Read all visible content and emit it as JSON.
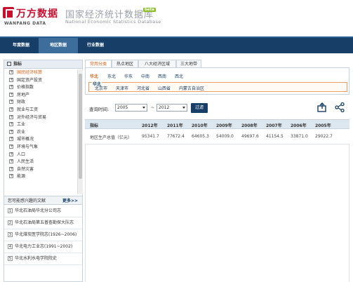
{
  "header": {
    "logo_cn": "万方数据",
    "logo_en": "WANFANG DATA",
    "site_title_cn": "国家经济统计数据库",
    "site_title_en": "National Economic Statistics Database",
    "beta": "beta"
  },
  "nav": {
    "items": [
      {
        "label": "年度数据"
      },
      {
        "label": "地区数据"
      },
      {
        "label": "行业数据"
      }
    ]
  },
  "sidebar": {
    "title": "指标",
    "items": [
      {
        "label": "国民经济核算"
      },
      {
        "label": "国定资产投资"
      },
      {
        "label": "价格指数"
      },
      {
        "label": "房地产"
      },
      {
        "label": "财政"
      },
      {
        "label": "就业与工资"
      },
      {
        "label": "对外经济与贸易"
      },
      {
        "label": "工业"
      },
      {
        "label": "农业"
      },
      {
        "label": "城市概况"
      },
      {
        "label": "环境与气象"
      },
      {
        "label": "人口"
      },
      {
        "label": "人民生活"
      },
      {
        "label": "自然灾害"
      },
      {
        "label": "能源"
      }
    ],
    "related_title": "您可能感兴趣的文献",
    "related_more": "更多>>",
    "related": [
      {
        "num": "1",
        "text": "华北石油局华北分公司志"
      },
      {
        "num": "2",
        "text": "华北石油局第五普查勘探大队志"
      },
      {
        "num": "3",
        "text": "华北煤炭医学院志(1926~2006)"
      },
      {
        "num": "4",
        "text": "华北电力工业志(1991~2002)"
      },
      {
        "num": "5",
        "text": "华北水利水电学院院史"
      }
    ]
  },
  "main": {
    "tabs": [
      {
        "label": "常用分类"
      },
      {
        "label": "热点地区"
      },
      {
        "label": "八大经济区域"
      },
      {
        "label": "三大地带"
      }
    ],
    "region_tabs": [
      {
        "label": "华北"
      },
      {
        "label": "东北"
      },
      {
        "label": "华东"
      },
      {
        "label": "中南"
      },
      {
        "label": "西南"
      },
      {
        "label": "西北"
      }
    ],
    "sub_label": "华北",
    "cities": [
      {
        "label": "北京市"
      },
      {
        "label": "天津市"
      },
      {
        "label": "河北省"
      },
      {
        "label": "山西省"
      },
      {
        "label": "内蒙古自治区"
      }
    ],
    "query_label": "查询时间:",
    "start_year": "2005",
    "dash": "~",
    "end_year": "2012",
    "filter_button": "过滤",
    "table": {
      "headers": [
        "指标",
        "2012年",
        "2011年",
        "2010年",
        "2009年",
        "2008年",
        "2007年",
        "2006年",
        "2005年"
      ],
      "rows": [
        [
          "地区生产总值（亿元）",
          "95341.7",
          "77672.4",
          "64605.3",
          "54009.0",
          "49697.6",
          "41154.5",
          "33871.0",
          "29022.7"
        ]
      ]
    }
  }
}
